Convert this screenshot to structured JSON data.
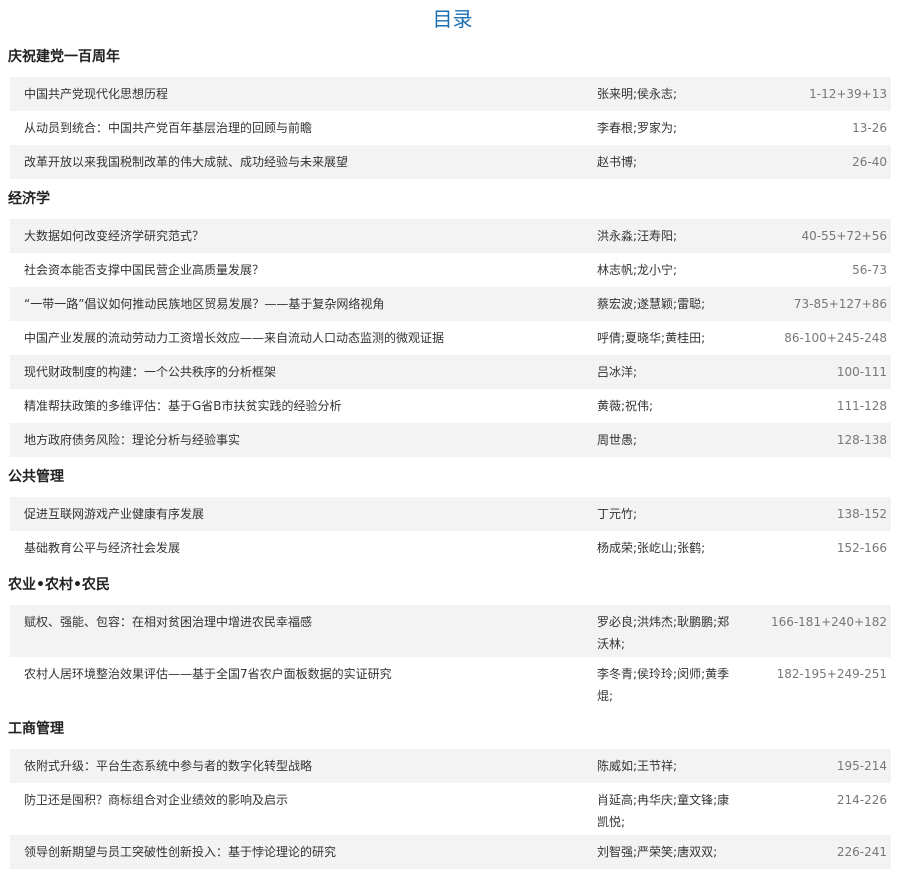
{
  "header": {
    "title": "目录"
  },
  "sections": [
    {
      "name": "庆祝建党一百周年",
      "items": [
        {
          "title": "中国共产党现代化思想历程",
          "authors": "张来明;侯永志;",
          "pages": "1-12+39+13"
        },
        {
          "title": "从动员到统合：中国共产党百年基层治理的回顾与前瞻",
          "authors": "李春根;罗家为;",
          "pages": "13-26"
        },
        {
          "title": "改革开放以来我国税制改革的伟大成就、成功经验与未来展望",
          "authors": "赵书博;",
          "pages": "26-40"
        }
      ]
    },
    {
      "name": "经济学",
      "items": [
        {
          "title": "大数据如何改变经济学研究范式？",
          "authors": "洪永淼;汪寿阳;",
          "pages": "40-55+72+56"
        },
        {
          "title": "社会资本能否支撑中国民营企业高质量发展？",
          "authors": "林志帆;龙小宁;",
          "pages": "56-73"
        },
        {
          "title": "“一带一路”倡议如何推动民族地区贸易发展？——基于复杂网络视角",
          "authors": "蔡宏波;遂慧颖;雷聪;",
          "pages": "73-85+127+86"
        },
        {
          "title": "中国产业发展的流动劳动力工资增长效应——来自流动人口动态监测的微观证据",
          "authors": "呼倩;夏晓华;黄桂田;",
          "pages": "86-100+245-248"
        },
        {
          "title": "现代财政制度的构建：一个公共秩序的分析框架",
          "authors": "吕冰洋;",
          "pages": "100-111"
        },
        {
          "title": "精准帮扶政策的多维评估：基于G省B市扶贫实践的经验分析",
          "authors": "黄薇;祝伟;",
          "pages": "111-128"
        },
        {
          "title": "地方政府债务风险：理论分析与经验事实",
          "authors": "周世愚;",
          "pages": "128-138"
        }
      ]
    },
    {
      "name": "公共管理",
      "items": [
        {
          "title": "促进互联网游戏产业健康有序发展",
          "authors": "丁元竹;",
          "pages": "138-152"
        },
        {
          "title": "基础教育公平与经济社会发展",
          "authors": "杨成荣;张屹山;张鹤;",
          "pages": "152-166"
        }
      ]
    },
    {
      "name": "农业•农村•农民",
      "items": [
        {
          "title": "赋权、强能、包容：在相对贫困治理中增进农民幸福感",
          "authors": "罗必良;洪炜杰;耿鹏鹏;郑沃林;",
          "pages": "166-181+240+182"
        },
        {
          "title": "农村人居环境整治效果评估——基于全国7省农户面板数据的实证研究",
          "authors": "李冬青;侯玲玲;闵师;黄季焜;",
          "pages": "182-195+249-251"
        }
      ]
    },
    {
      "name": "工商管理",
      "items": [
        {
          "title": "依附式升级：平台生态系统中参与者的数字化转型战略",
          "authors": "陈威如;王节祥;",
          "pages": "195-214"
        },
        {
          "title": "防卫还是囤积？商标组合对企业绩效的影响及启示",
          "authors": "肖延高;冉华庆;童文锋;康凯悦;",
          "pages": "214-226"
        },
        {
          "title": "领导创新期望与员工突破性创新投入：基于悖论理论的研究",
          "authors": "刘智强;严荣笑;唐双双;",
          "pages": "226-241"
        }
      ]
    }
  ]
}
